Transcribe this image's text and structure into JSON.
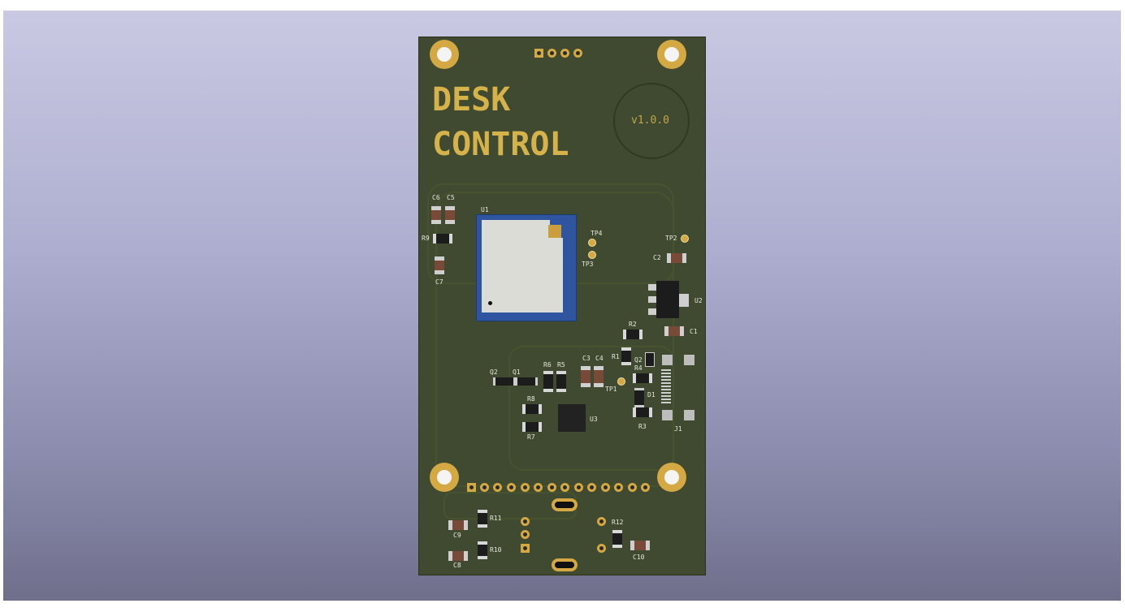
{
  "board": {
    "title_line1": "DESK",
    "title_line2": "CONTROL",
    "version": "v1.0.0"
  },
  "labels": {
    "U1": "U1",
    "U2": "U2",
    "U3": "U3",
    "J1": "J1",
    "D1": "D1",
    "C1": "C1",
    "C2": "C2",
    "C3": "C3",
    "C4": "C4",
    "C5": "C5",
    "C6": "C6",
    "C7": "C7",
    "C8": "C8",
    "C9": "C9",
    "C10": "C10",
    "R1": "R1",
    "R2": "R2",
    "R3": "R3",
    "R4": "R4",
    "R5": "R5",
    "R6": "R6",
    "R7": "R7",
    "R8": "R8",
    "R9": "R9",
    "R10": "R10",
    "R11": "R11",
    "R12": "R12",
    "Q1": "Q1",
    "Q2": "Q2",
    "TP1": "TP1",
    "TP2": "TP2",
    "TP3": "TP3",
    "TP4": "TP4"
  },
  "colors": {
    "background_top": "#c9c9e3",
    "background_bottom": "#6f6f8c",
    "soldermask": "#3f4a30",
    "silkscreen_title": "#d6b24a",
    "copper_pad": "#d4a843"
  }
}
